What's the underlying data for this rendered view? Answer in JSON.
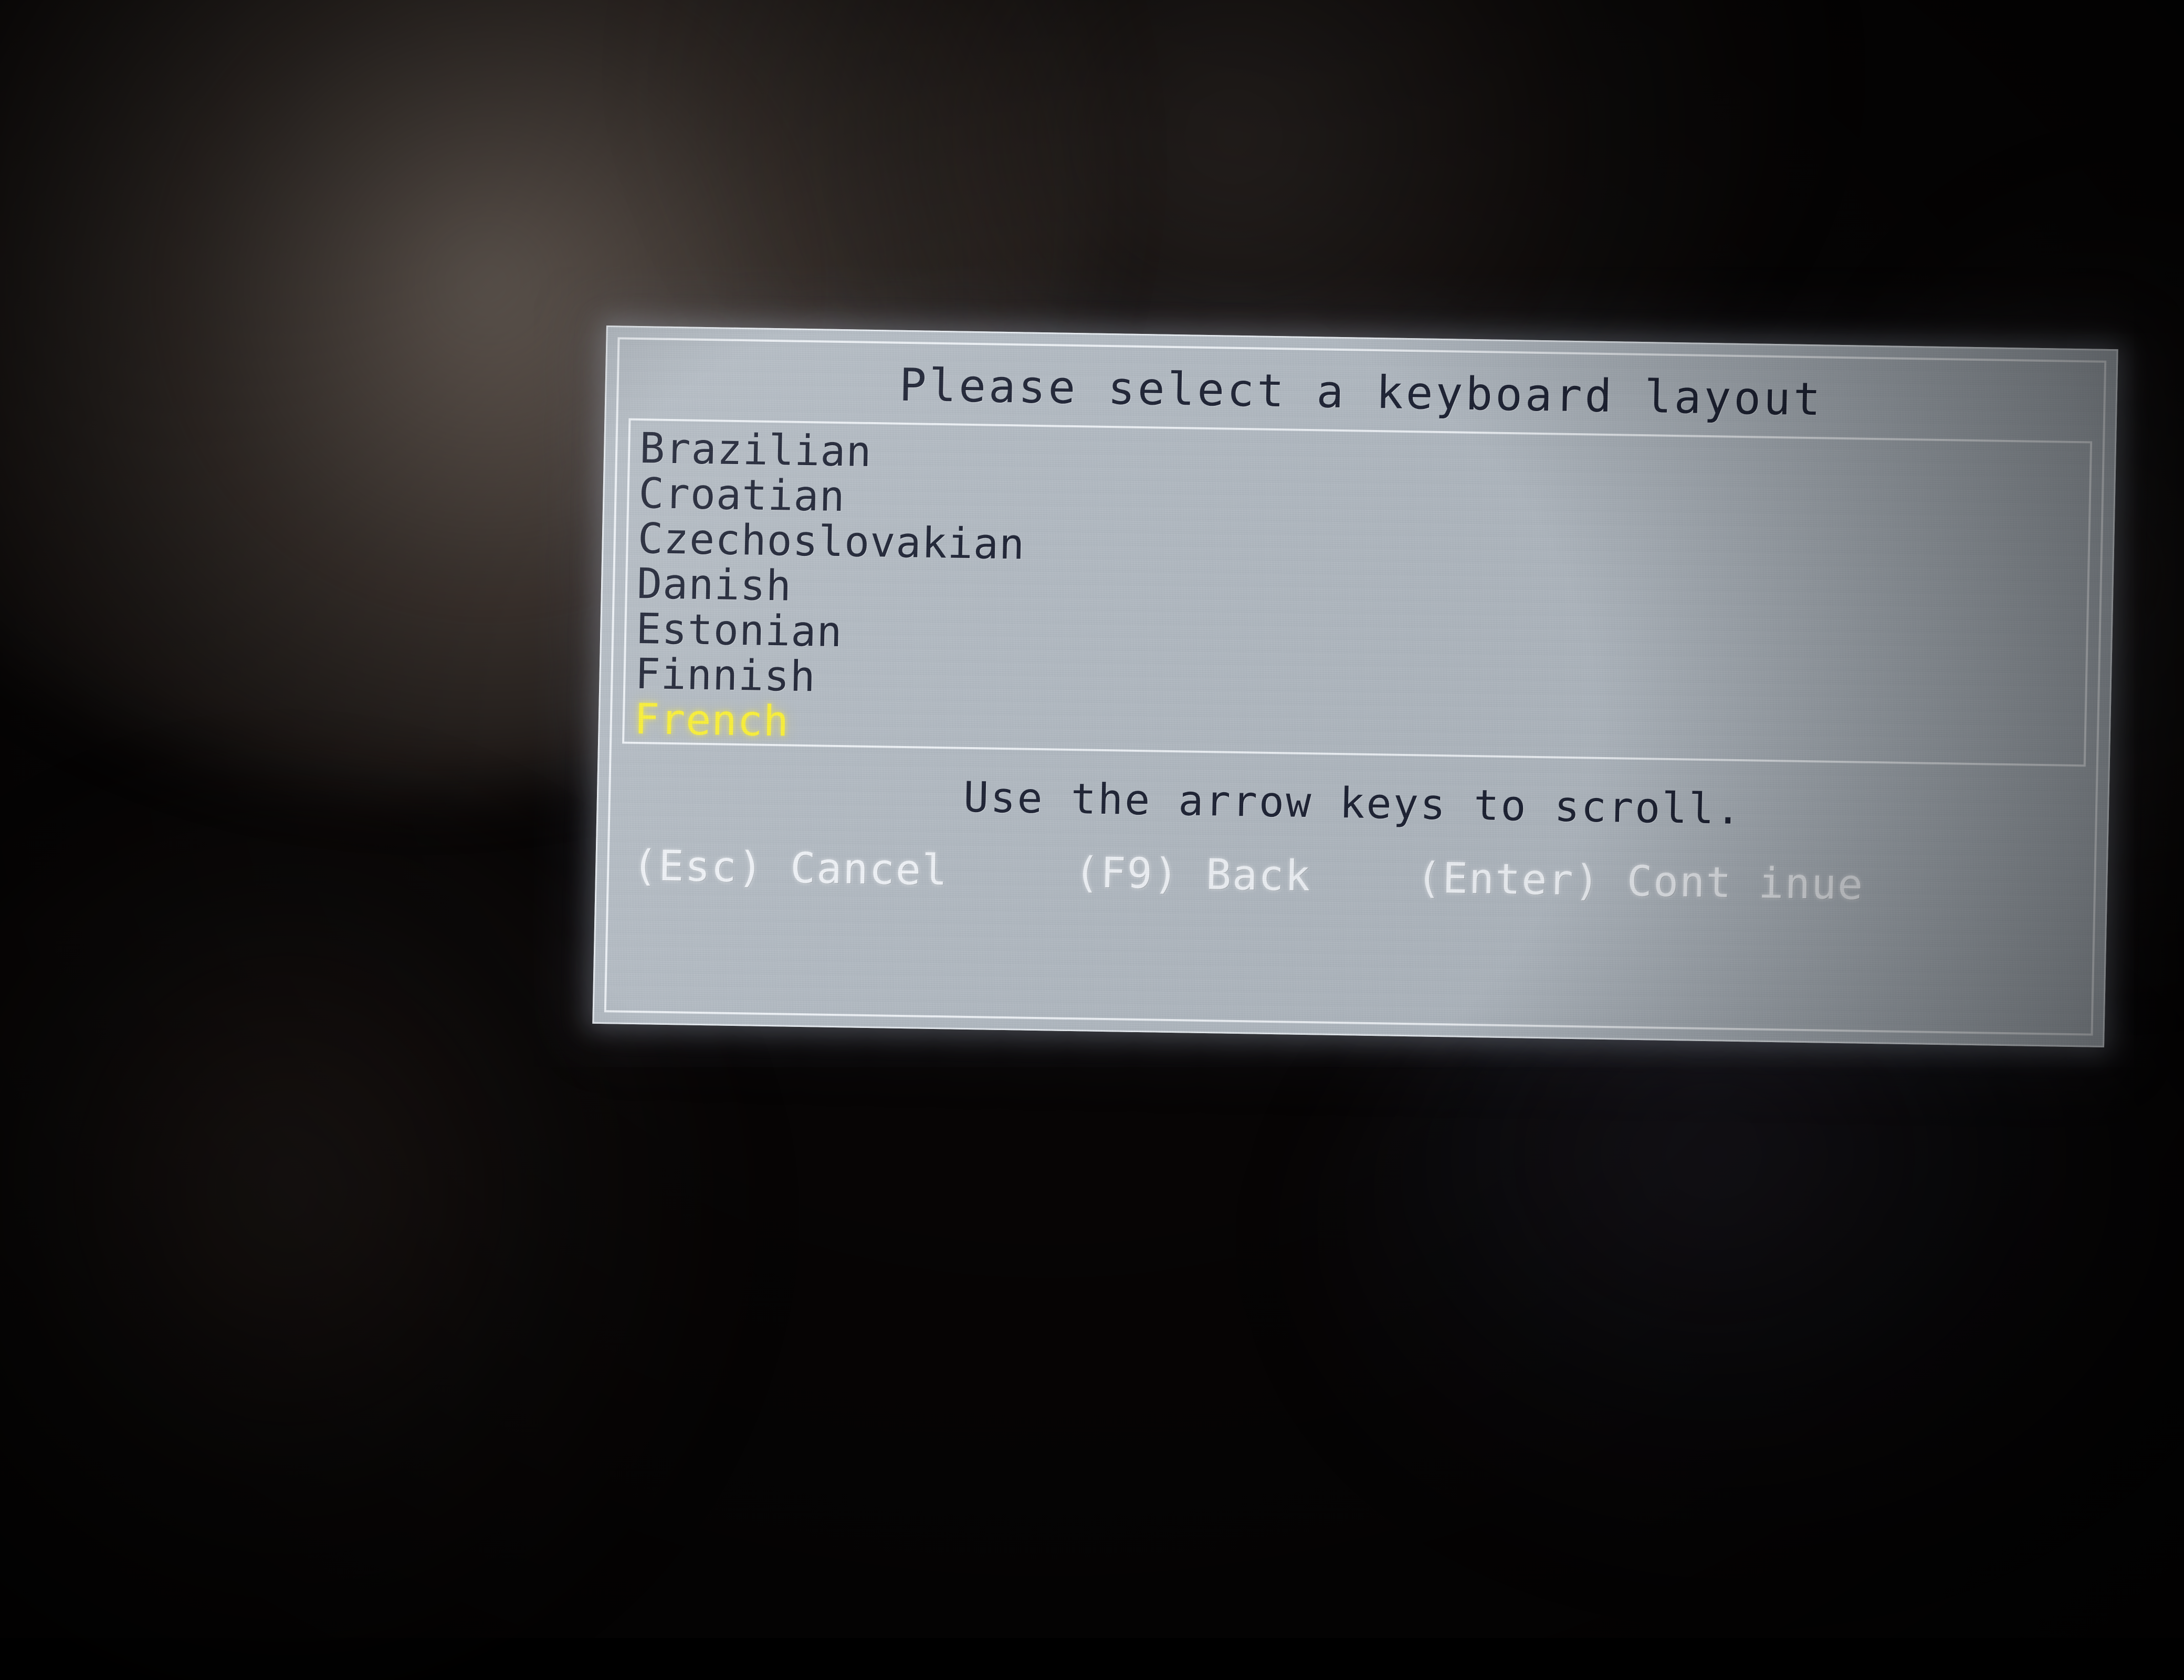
{
  "screen": {
    "background_color": "#070505",
    "panel_color": "#b3bbc3",
    "frame_color": "#f2f6fa",
    "text_color": "#14192b",
    "highlight_color": "#fff42a",
    "key_text_color": "#f4f7fb"
  },
  "dialog": {
    "title": "Please select a keyboard layout",
    "scroll_hint": "Use the arrow keys to scroll.",
    "list": {
      "items": [
        {
          "label": "Brazilian",
          "selected": false
        },
        {
          "label": "Croatian",
          "selected": false
        },
        {
          "label": "Czechoslovakian",
          "selected": false
        },
        {
          "label": "Danish",
          "selected": false
        },
        {
          "label": "Estonian",
          "selected": false
        },
        {
          "label": "Finnish",
          "selected": false
        },
        {
          "label": "French",
          "selected": true
        }
      ],
      "selected_index": 6,
      "selected_value": "French"
    },
    "keys": [
      {
        "key": "(Esc)",
        "action": "Cancel",
        "text": "(Esc) Cancel"
      },
      {
        "key": "(F9)",
        "action": "Back",
        "text": "(F9) Back"
      },
      {
        "key": "(Enter)",
        "action": "Continue",
        "text": "(Enter) Cont inue"
      }
    ]
  }
}
